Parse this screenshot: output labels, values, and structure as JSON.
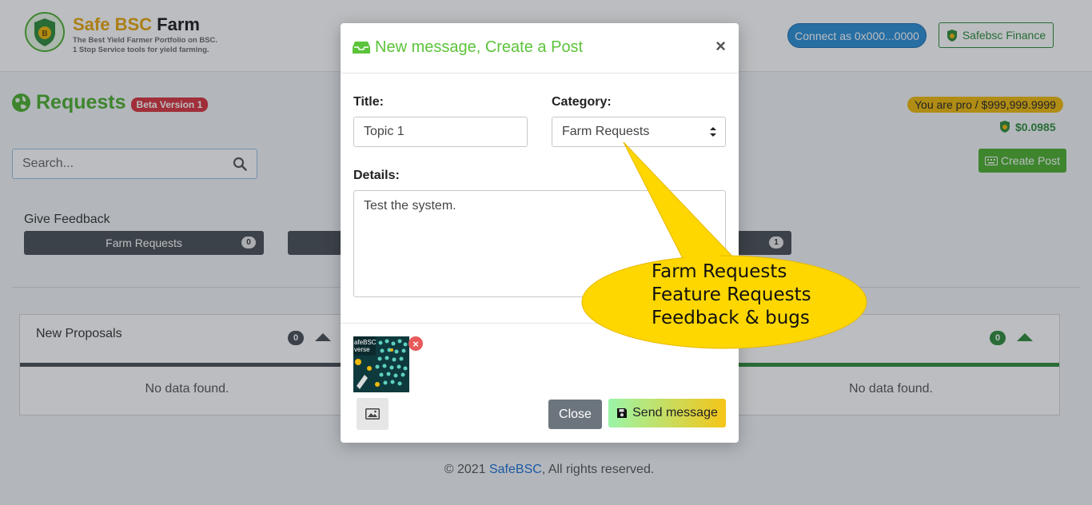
{
  "header": {
    "brand_part1": "Safe BSC",
    "brand_part2": "Farm",
    "tagline_line1": "The Best Yield Farmer Portfolio on BSC.",
    "tagline_line2": "1 Stop Service tools for yield farming.",
    "connect_label": "Connect as 0x000...0000",
    "finance_label": "Safebsc Finance"
  },
  "page": {
    "title": "Requests",
    "beta_badge": "Beta Version 1",
    "pro_badge": "You are pro / $999,999.9999",
    "price": "$0.0985",
    "create_post_label": "Create Post",
    "search_placeholder": "Search...",
    "give_feedback_label": "Give Feedback",
    "categories": [
      {
        "label": "Farm Requests",
        "count": "0"
      },
      {
        "label": "",
        "count": ""
      },
      {
        "label": "",
        "count": "1"
      }
    ]
  },
  "panels": [
    {
      "title": "New Proposals",
      "count": "0",
      "empty_text": "No data found."
    },
    {
      "title": "",
      "count": "0",
      "empty_text": "No data found."
    }
  ],
  "footer": {
    "prefix": "© 2021 ",
    "link": "SafeBSC",
    "suffix": ", All rights reserved."
  },
  "modal": {
    "title": "New message, Create a Post",
    "close_symbol": "×",
    "title_label": "Title:",
    "title_value": "Topic 1",
    "category_label": "Category:",
    "category_value": "Farm Requests",
    "details_label": "Details:",
    "details_value": "Test the system.",
    "attachment_text_1": "afeBSC",
    "attachment_text_2": "verse",
    "remove_symbol": "×",
    "close_button": "Close",
    "send_button": "Send message"
  },
  "callout": {
    "options": [
      "Farm Requests",
      "Feature Requests",
      "Feedback & bugs"
    ]
  },
  "colors": {
    "brand_green": "#4caf2f",
    "gold": "#f0b90b",
    "beta_red": "#d9343e",
    "callout_yellow": "#ffd700"
  }
}
